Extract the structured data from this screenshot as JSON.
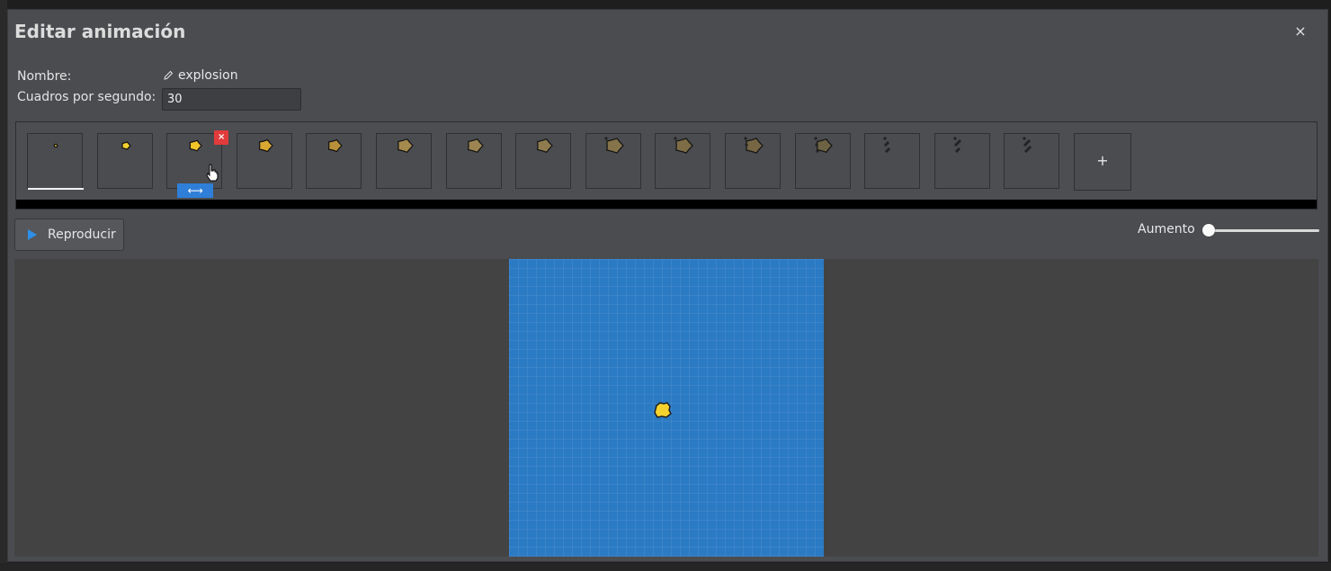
{
  "dialog": {
    "title": "Editar animación",
    "close_label": "×"
  },
  "form": {
    "name_label": "Nombre:",
    "name_value": "explosion",
    "fps_label": "Cuadros por segundo:",
    "fps_value": "30"
  },
  "frames": {
    "count": 15,
    "selected_index": 0,
    "hovered_index": 2,
    "delete_label": "×",
    "move_label": "⟷",
    "add_label": "+"
  },
  "toolbar": {
    "play_label": "Reproducir",
    "zoom_label": "Aumento",
    "zoom_value": 0
  },
  "icons": {
    "close": "close-icon",
    "edit": "pencil-icon",
    "play": "play-icon",
    "delete": "delete-icon",
    "move": "move-handle-icon",
    "add": "plus-icon",
    "cursor": "hand-pointer-icon"
  },
  "colors": {
    "dialog_bg": "#4a4c50",
    "canvas_bg": "#2b7ac4",
    "accent": "#2e8fe8",
    "delete": "#e23b3b",
    "explosion_fill": "#f5d22e"
  }
}
